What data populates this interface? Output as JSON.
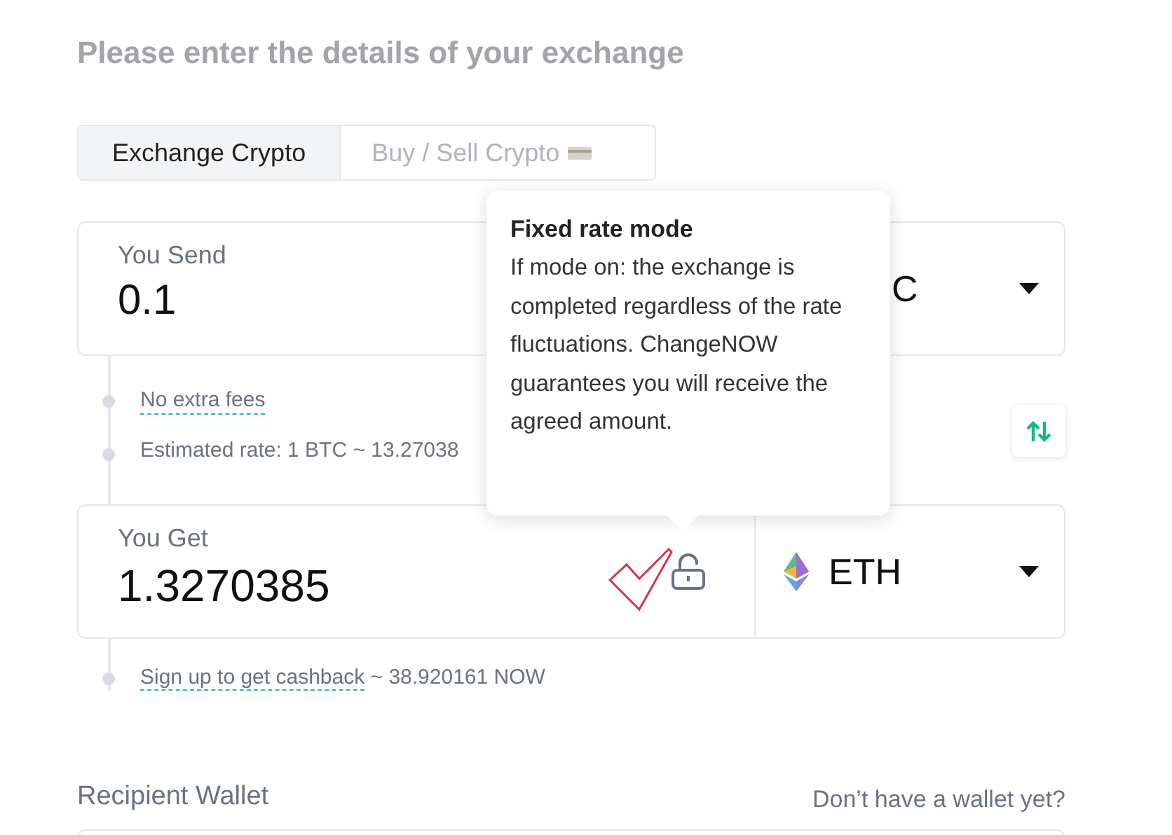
{
  "heading": "Please enter the details of your exchange",
  "tabs": [
    {
      "label": "Exchange Crypto",
      "selected": true
    },
    {
      "label": "Buy / Sell Crypto",
      "selected": false
    }
  ],
  "send": {
    "label": "You Send",
    "value": "0.1",
    "currency": "C"
  },
  "info": [
    "No extra fees",
    "Estimated rate: 1 BTC ~ 13.27038"
  ],
  "get": {
    "label": "You Get",
    "value": "1.3270385",
    "currency": "ETH",
    "fixed_rate": false
  },
  "cashback": {
    "link": "Sign up to get cashback",
    "amount": " ~ 38.920161 NOW"
  },
  "recipient": {
    "label": "Recipient Wallet",
    "link": "Don’t have a wallet yet?"
  },
  "tooltip": {
    "title": "Fixed rate mode",
    "text": "If mode on: the exchange is completed regardless of the rate fluctuations. ChangeNOW guarantees you will receive the agreed amount."
  }
}
